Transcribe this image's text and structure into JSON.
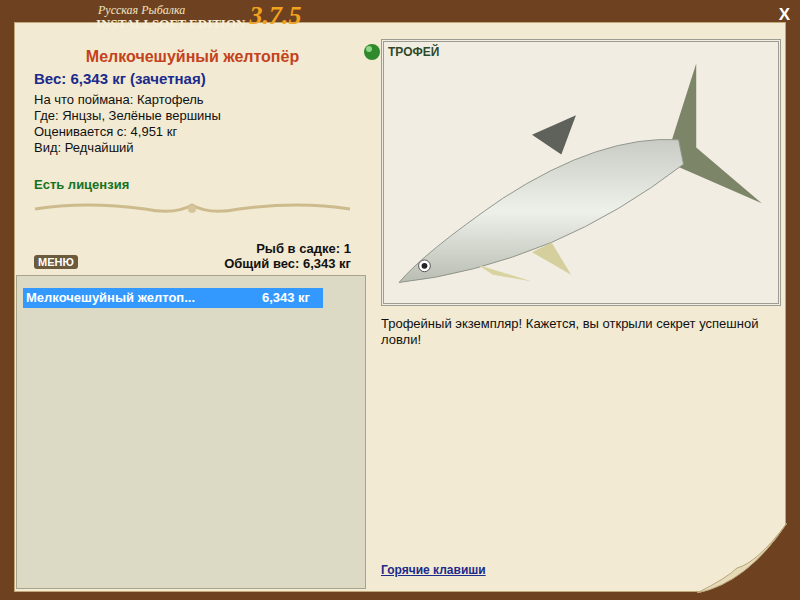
{
  "window": {
    "brand_top": "Русская Рыбалка",
    "brand_bottom": "INSTALLSOFT EDITION",
    "version": "3.7.5",
    "close": "X"
  },
  "fish": {
    "name": "Мелкочешуйный желтопёр",
    "weight": "Вес: 6,343 кг (зачетная)",
    "details": [
      "На что поймана: Картофель",
      "Где: Янцзы, Зелёные вершины",
      "Оценивается с: 4,951 кг",
      "Вид: Редчайший"
    ],
    "license": "Есть лицензия"
  },
  "keepnet": {
    "menu": "МЕНЮ",
    "count": "Рыб в садке: 1",
    "total": "Общий вес: 6,343 кг",
    "rows": [
      {
        "name": "Мелкочешуйный желтоп...",
        "weight": "6,343 кг",
        "selected": true
      }
    ]
  },
  "picture": {
    "badge": "ТРОФЕЙ"
  },
  "message": "Трофейный экземпляр! Кажется, вы открыли секрет успешной ловли!",
  "hotkeys": "Горячие клавиши"
}
